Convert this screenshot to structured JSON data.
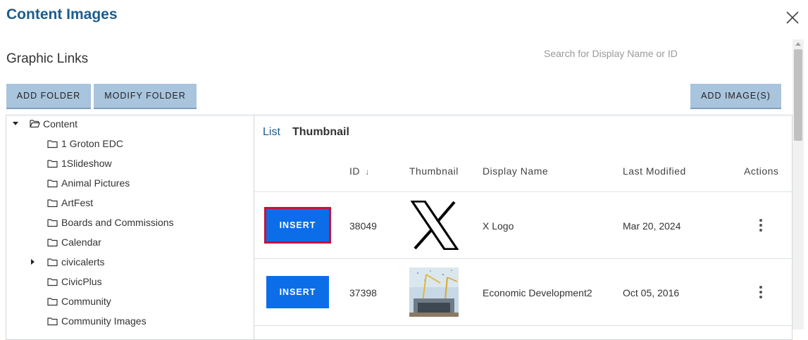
{
  "dialog": {
    "title": "Content Images",
    "subtitle": "Graphic Links",
    "search_placeholder": "Search for Display Name or ID"
  },
  "toolbar": {
    "add_folder": "ADD FOLDER",
    "modify_folder": "MODIFY FOLDER",
    "add_images": "ADD IMAGE(S)"
  },
  "tree": {
    "root": "Content",
    "items": [
      "1 Groton EDC",
      "1Slideshow",
      "Animal Pictures",
      "ArtFest",
      "Boards and Commissions",
      "Calendar",
      "civicalerts",
      "CivicPlus",
      "Community",
      "Community Images"
    ]
  },
  "view_tabs": {
    "list": "List",
    "thumbnail": "Thumbnail"
  },
  "table": {
    "headers": {
      "id": "ID",
      "sort_arrow": "↓",
      "thumbnail": "Thumbnail",
      "display_name": "Display Name",
      "last_modified": "Last Modified",
      "actions": "Actions"
    },
    "insert_label": "INSERT",
    "rows": [
      {
        "id": "38049",
        "thumbnail": "x-logo-thumbnail",
        "display_name": "X Logo",
        "last_modified": "Mar 20, 2024"
      },
      {
        "id": "37398",
        "thumbnail": "construction-photo-thumbnail",
        "display_name": "Economic Development2",
        "last_modified": "Oct 05, 2016"
      }
    ]
  },
  "colors": {
    "title": "#1d5c8c",
    "button_bg": "#a9c4dd",
    "insert_bg": "#0b6ee8",
    "focus_ring": "#c4123b"
  }
}
